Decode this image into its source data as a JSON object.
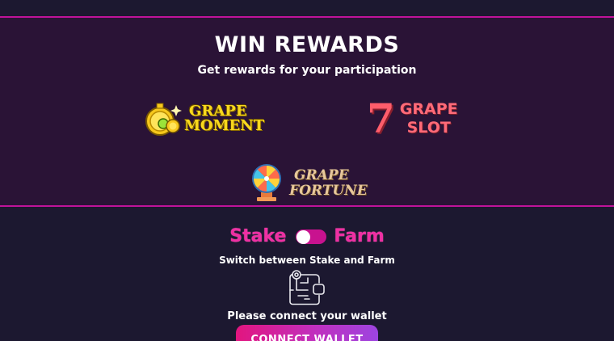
{
  "rewards": {
    "title": "WIN REWARDS",
    "subtitle": "Get rewards for your participation",
    "games": {
      "moment": {
        "line1": "GRAPE",
        "line2": "MOMENT"
      },
      "slot": {
        "seven": "7",
        "line1": "GRAPE",
        "line2": "SLOT"
      },
      "fortune": {
        "line1": "GRAPE",
        "line2": "FORTUNE"
      }
    }
  },
  "mode_toggle": {
    "left_label": "Stake",
    "right_label": "Farm",
    "state": "Stake",
    "hint": "Switch between Stake and Farm"
  },
  "wallet": {
    "message": "Please connect your wallet",
    "button_label": "CONNECT WALLET"
  },
  "colors": {
    "background": "#1c1830",
    "banner": "#2a1336",
    "accent_pink": "#ef2fa3",
    "border": "#c0139a"
  }
}
